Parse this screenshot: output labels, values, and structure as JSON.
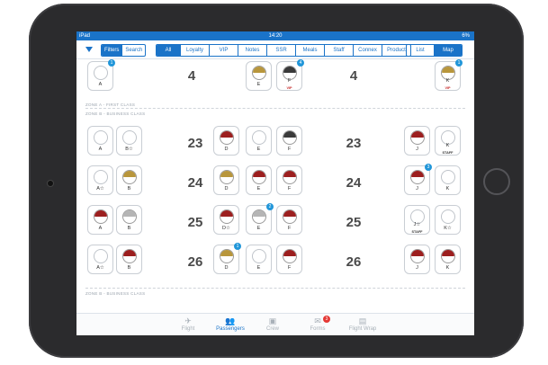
{
  "status": {
    "device": "iPad",
    "time": "14:20",
    "battery": "6%"
  },
  "toolbar": {
    "filters_label": "Filters",
    "search_label": "Search",
    "tabs": [
      "All",
      "Loyalty",
      "VIP",
      "Notes",
      "SSR",
      "Meals",
      "Staff",
      "Connex",
      "Product"
    ],
    "view_list": "List",
    "view_map": "Map"
  },
  "zones": {
    "first": "ZONE A - FIRST CLASS",
    "business": "ZONE B - BUSINESS CLASS"
  },
  "rows": {
    "r4": "4",
    "r23": "23",
    "r24": "24",
    "r25": "25",
    "r26": "26"
  },
  "seats": {
    "s4a": {
      "letter": "A",
      "badge": "1"
    },
    "s4e": {
      "letter": "E"
    },
    "s4f": {
      "letter": "F",
      "tag": "VIP",
      "badge": "4"
    },
    "s4k": {
      "letter": "K",
      "tag": "VIP",
      "badge": "1"
    },
    "s23a": {
      "letter": "A"
    },
    "s23b": {
      "letter": "B☆"
    },
    "s23d": {
      "letter": "D"
    },
    "s23e": {
      "letter": "E"
    },
    "s23f": {
      "letter": "F"
    },
    "s23j": {
      "letter": "J"
    },
    "s23k": {
      "letter": "K",
      "tag": "STAFF"
    },
    "s24a": {
      "letter": "A☆"
    },
    "s24b": {
      "letter": "B"
    },
    "s24d": {
      "letter": "D"
    },
    "s24e": {
      "letter": "E"
    },
    "s24f": {
      "letter": "F"
    },
    "s24j": {
      "letter": "J",
      "badge": "3"
    },
    "s24k": {
      "letter": "K"
    },
    "s25a": {
      "letter": "A"
    },
    "s25b": {
      "letter": "B"
    },
    "s25d": {
      "letter": "D☆"
    },
    "s25e": {
      "letter": "E",
      "badge": "2"
    },
    "s25f": {
      "letter": "F"
    },
    "s25j": {
      "letter": "J☆",
      "tag": "STAFF"
    },
    "s25k": {
      "letter": "K☆"
    },
    "s26a": {
      "letter": "A☆"
    },
    "s26b": {
      "letter": "B"
    },
    "s26d": {
      "letter": "D",
      "badge": "1"
    },
    "s26e": {
      "letter": "E"
    },
    "s26f": {
      "letter": "F"
    },
    "s26j": {
      "letter": "J"
    },
    "s26k": {
      "letter": "K"
    }
  },
  "tabbar": {
    "flight": "Flight",
    "passengers": "Passengers",
    "crew": "Crew",
    "forms": "Forms",
    "forms_badge": "3",
    "flight_wrap": "Flight Wrap"
  },
  "colors": {
    "accent": "#1a73c8",
    "badge": "#2196d9",
    "hair_red": "#9c1f1f",
    "hair_blonde": "#b8963c",
    "hair_dark": "#3a3a3a",
    "hair_grey": "#b5b5b5"
  }
}
